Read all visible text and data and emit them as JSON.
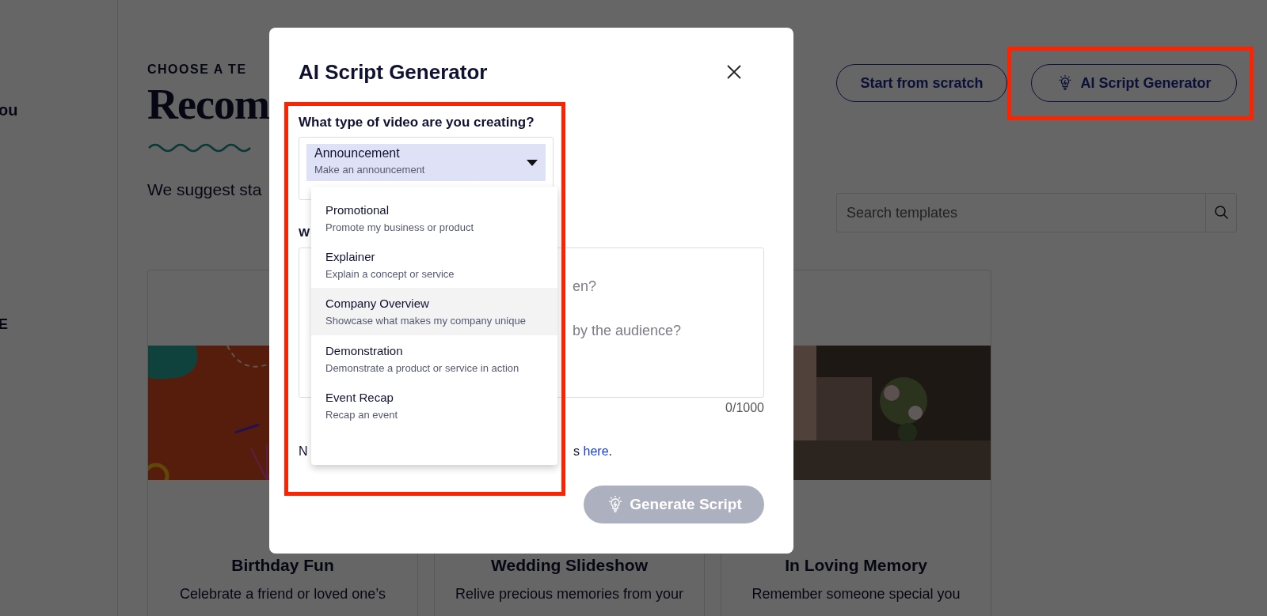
{
  "sidebar": {
    "items": [
      {
        "label": "ou"
      },
      {
        "label": "E"
      }
    ]
  },
  "header": {
    "eyebrow": "CHOOSE A TE",
    "title": "Recom",
    "subtitle": "We suggest sta"
  },
  "actions": [
    {
      "label": "Start from scratch",
      "kind": "plain"
    },
    {
      "label": "AI Script Generator",
      "kind": "ai"
    }
  ],
  "search": {
    "placeholder": "Search templates"
  },
  "templates": [
    {
      "title": "Birthday Fun",
      "description": "Celebrate a friend or loved one’s"
    },
    {
      "title": "Wedding Slideshow",
      "description": "Relive precious memories from your"
    },
    {
      "title": "In Loving Memory",
      "description": "Remember someone special you"
    }
  ],
  "modal": {
    "title": "AI Script Generator",
    "type_label": "What type of video are you creating?",
    "selected_type": {
      "title": "Announcement",
      "subtitle": "Make an announcement"
    },
    "options": [
      {
        "title": "Promotional",
        "subtitle": "Promote my business or product",
        "highlighted": false
      },
      {
        "title": "Explainer",
        "subtitle": "Explain a concept or service",
        "highlighted": false
      },
      {
        "title": "Company Overview",
        "subtitle": "Showcase what makes my company unique",
        "highlighted": true
      },
      {
        "title": "Demonstration",
        "subtitle": "Demonstrate a product or service in action",
        "highlighted": false
      },
      {
        "title": "Event Recap",
        "subtitle": "Recap an event",
        "highlighted": false
      }
    ],
    "second_label": "W",
    "textarea_hints": [
      "en?",
      "by the audience?"
    ],
    "counter": "0/1000",
    "note": {
      "start": "N",
      "end": "s",
      "link": "here",
      "tail": "."
    },
    "generate_button": {
      "label": "Generate Script",
      "disabled": true
    }
  }
}
